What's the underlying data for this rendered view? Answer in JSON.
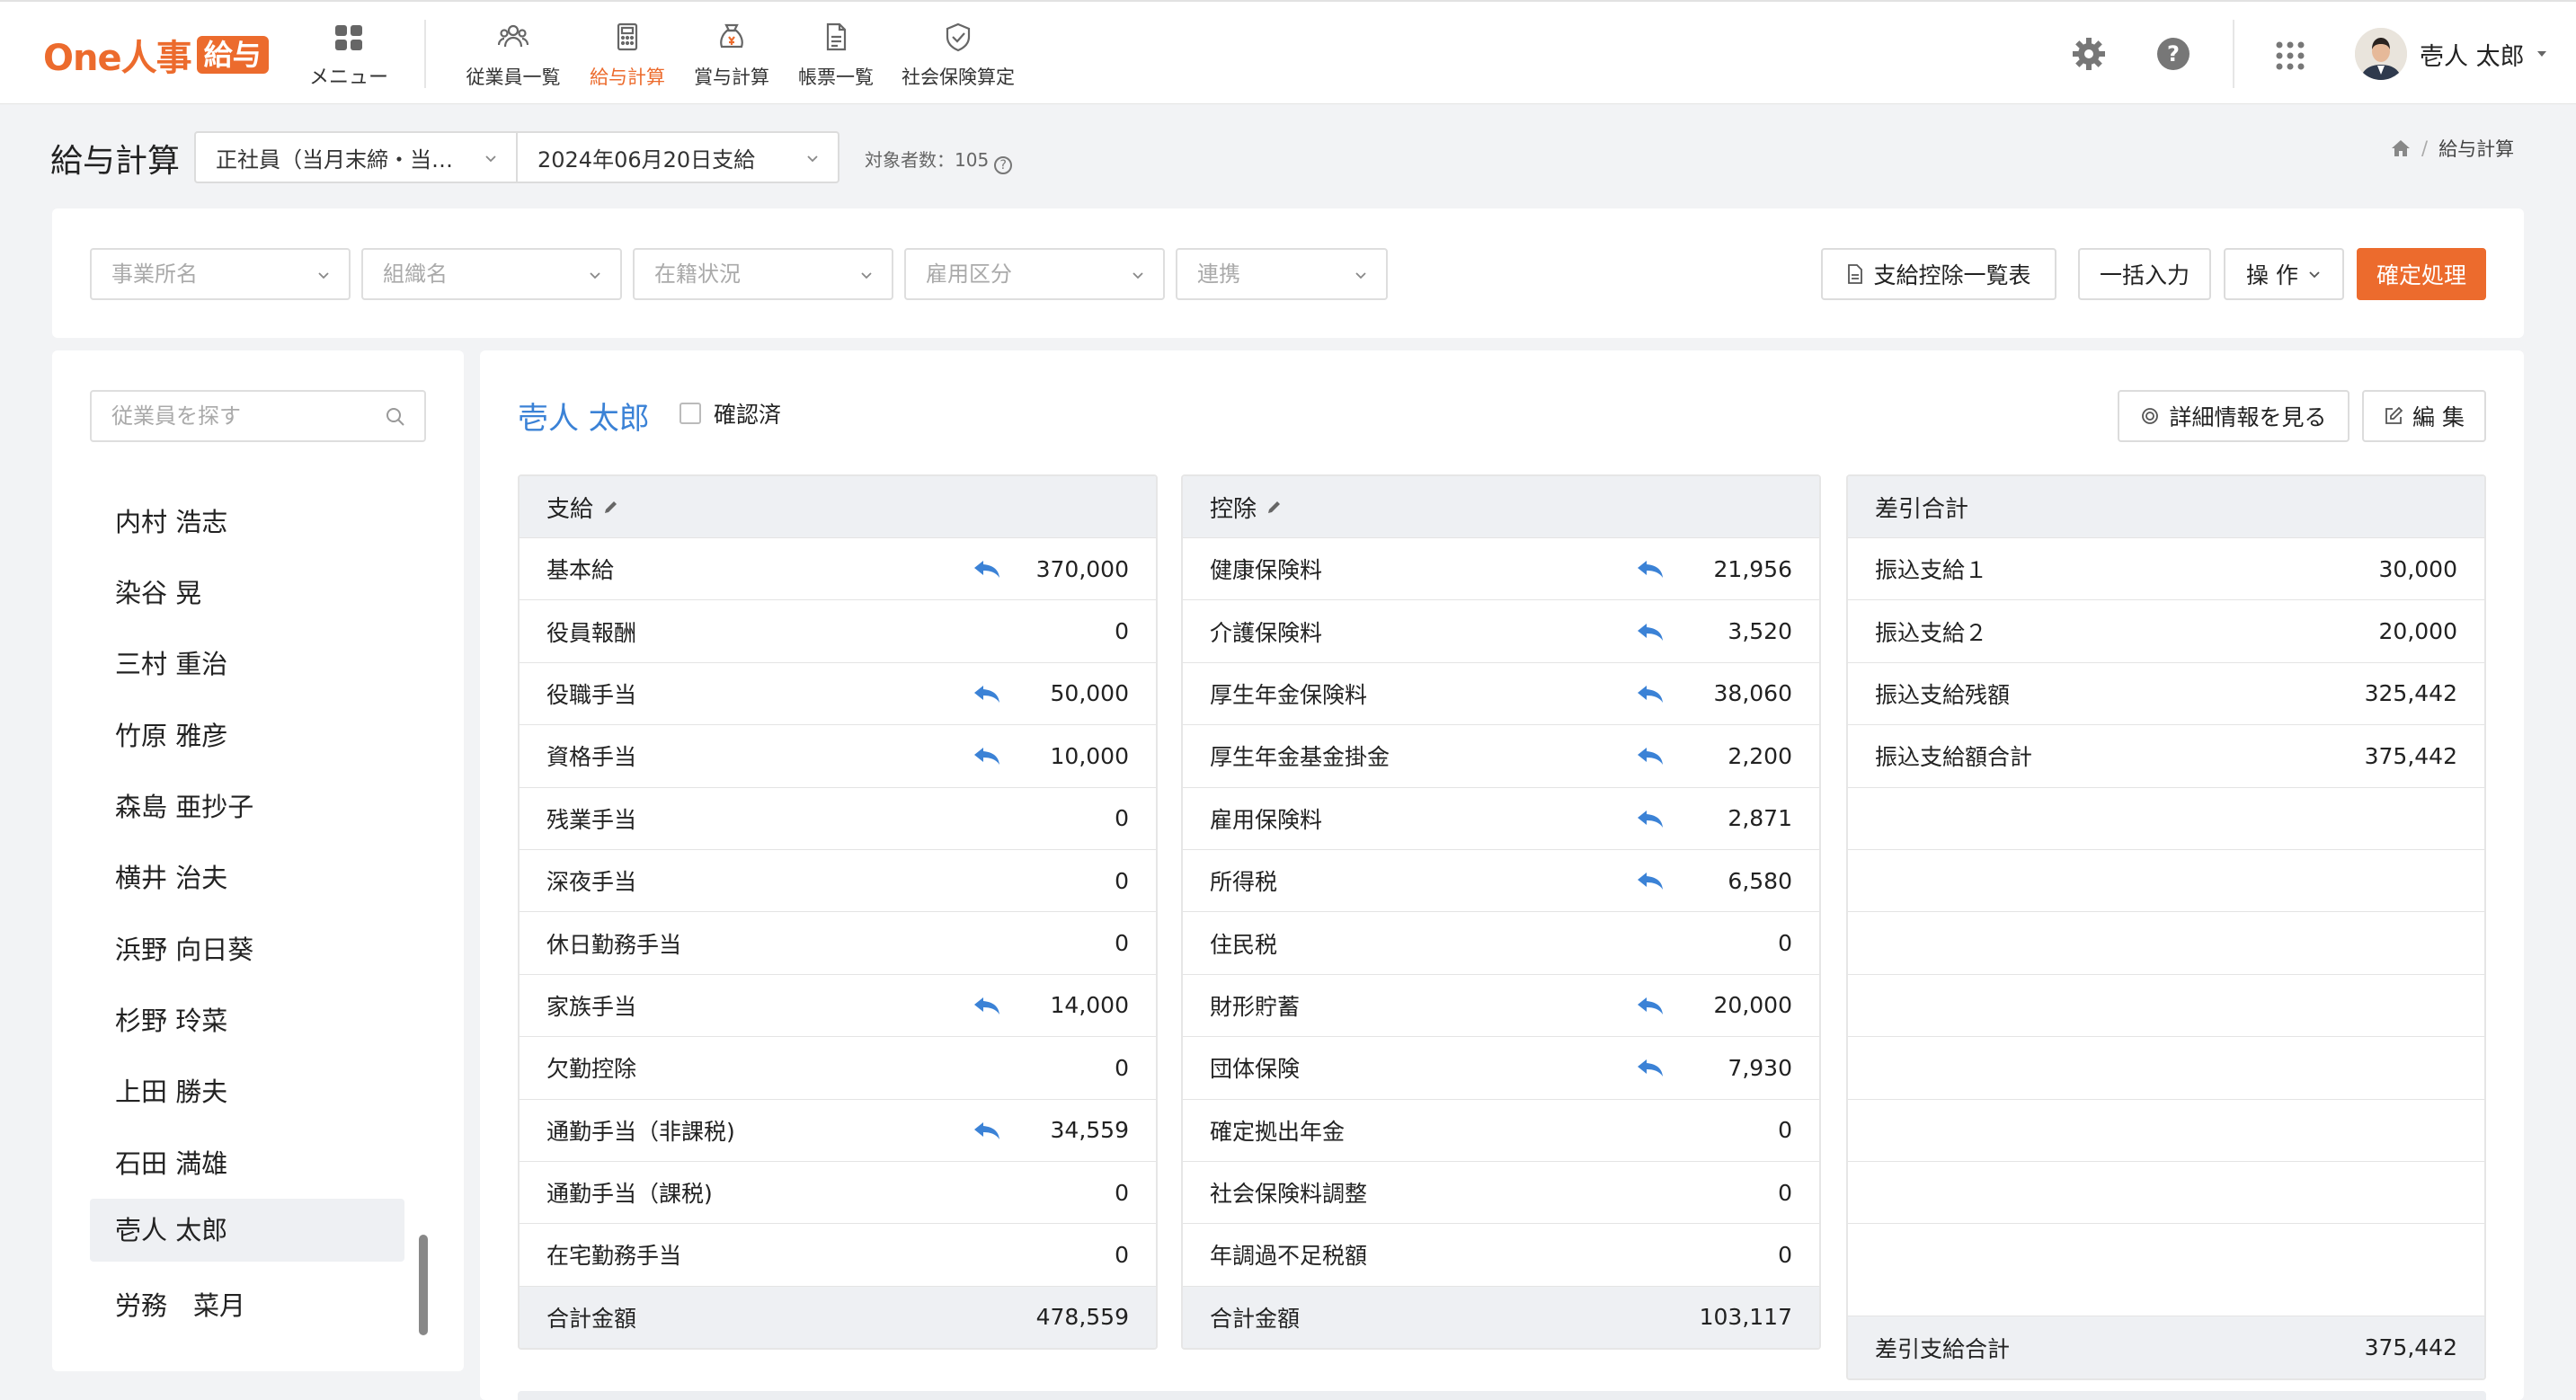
{
  "app": {
    "logo_text": "One人事",
    "logo_badge": "給与",
    "menu_label": "メニュー",
    "nav": [
      {
        "label": "従業員一覧",
        "icon": "people-icon"
      },
      {
        "label": "給与計算",
        "icon": "calculator-icon"
      },
      {
        "label": "賞与計算",
        "icon": "bonus-bag-icon"
      },
      {
        "label": "帳票一覧",
        "icon": "document-icon"
      },
      {
        "label": "社会保険算定",
        "icon": "shield-check-icon"
      }
    ],
    "active_nav": "給与計算",
    "user_name": "壱人 太郎",
    "accent_color": "#ec6b2d"
  },
  "subheader": {
    "title": "給与計算",
    "employee_type": "正社員（当月末締・当…",
    "pay_date": "2024年06月20日支給",
    "count_label": "対象者数：105",
    "breadcrumb": "給与計算"
  },
  "filters": {
    "office": "事業所名",
    "org": "組織名",
    "status": "在籍状況",
    "employment": "雇用区分",
    "link": "連携",
    "btn_list": "支給控除一覧表",
    "btn_bulk": "一括入力",
    "btn_ops": "操 作",
    "btn_confirm": "確定処理"
  },
  "sidebar": {
    "search_placeholder": "従業員を探す",
    "employees": [
      "内村 浩志",
      "染谷 晃",
      "三村 重治",
      "竹原 雅彦",
      "森島 亜抄子",
      "横井 治夫",
      "浜野 向日葵",
      "杉野 玲菜",
      "上田 勝夫",
      "石田 満雄",
      "壱人 太郎",
      "労務　菜月"
    ],
    "selected": "壱人 太郎"
  },
  "detail": {
    "name": "壱人 太郎",
    "confirmed_label": "確認済",
    "btn_detail": "詳細情報を見る",
    "btn_edit": "編 集"
  },
  "payments": {
    "title": "支給",
    "rows": [
      {
        "label": "基本給",
        "value": "370,000",
        "ret": true
      },
      {
        "label": "役員報酬",
        "value": "0",
        "ret": false
      },
      {
        "label": "役職手当",
        "value": "50,000",
        "ret": true
      },
      {
        "label": "資格手当",
        "value": "10,000",
        "ret": true
      },
      {
        "label": "残業手当",
        "value": "0",
        "ret": false
      },
      {
        "label": "深夜手当",
        "value": "0",
        "ret": false
      },
      {
        "label": "休日勤務手当",
        "value": "0",
        "ret": false
      },
      {
        "label": "家族手当",
        "value": "14,000",
        "ret": true
      },
      {
        "label": "欠勤控除",
        "value": "0",
        "ret": false
      },
      {
        "label": "通勤手当（非課税)",
        "value": "34,559",
        "ret": true
      },
      {
        "label": "通勤手当（課税)",
        "value": "0",
        "ret": false
      },
      {
        "label": "在宅勤務手当",
        "value": "0",
        "ret": false
      }
    ],
    "total_label": "合計金額",
    "total_value": "478,559"
  },
  "deductions": {
    "title": "控除",
    "rows": [
      {
        "label": "健康保険料",
        "value": "21,956",
        "ret": true
      },
      {
        "label": "介護保険料",
        "value": "3,520",
        "ret": true
      },
      {
        "label": "厚生年金保険料",
        "value": "38,060",
        "ret": true
      },
      {
        "label": "厚生年金基金掛金",
        "value": "2,200",
        "ret": true
      },
      {
        "label": "雇用保険料",
        "value": "2,871",
        "ret": true
      },
      {
        "label": "所得税",
        "value": "6,580",
        "ret": true
      },
      {
        "label": "住民税",
        "value": "0",
        "ret": false
      },
      {
        "label": "財形貯蓄",
        "value": "20,000",
        "ret": true
      },
      {
        "label": "団体保険",
        "value": "7,930",
        "ret": true
      },
      {
        "label": "確定拠出年金",
        "value": "0",
        "ret": false
      },
      {
        "label": "社会保険料調整",
        "value": "0",
        "ret": false
      },
      {
        "label": "年調過不足税額",
        "value": "0",
        "ret": false
      }
    ],
    "total_label": "合計金額",
    "total_value": "103,117"
  },
  "net": {
    "title": "差引合計",
    "rows": [
      {
        "label": "振込支給１",
        "value": "30,000"
      },
      {
        "label": "振込支給２",
        "value": "20,000"
      },
      {
        "label": "振込支給残額",
        "value": "325,442"
      },
      {
        "label": "振込支給額合計",
        "value": "375,442"
      }
    ],
    "total_label": "差引支給合計",
    "total_value": "375,442"
  }
}
